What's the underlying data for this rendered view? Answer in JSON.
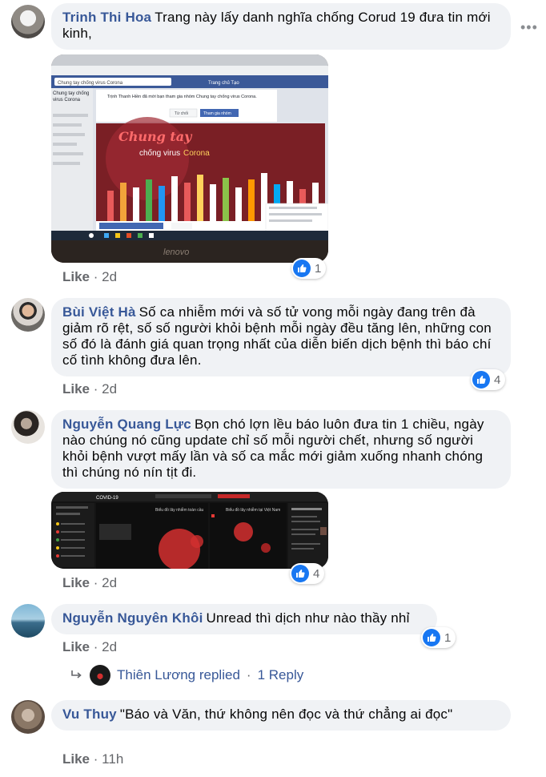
{
  "comments": [
    {
      "author": "Trinh Thi Hoa",
      "text": "Trang này lấy danh nghĩa chống Corud 19 đưa tin mới kinh,",
      "like": "Like",
      "sep": "·",
      "time": "2d",
      "reactions": "1",
      "image": {
        "search": "Chung tay chống virus Corona",
        "prompt": "Trịnh Thanh Hiền đã mời bạn tham gia nhóm Chung tay chống virus Corona.",
        "btn_decline": "Từ chối",
        "btn_join": "Tham gia nhóm",
        "banner_line1": "Chung tay",
        "banner_line2a": "chống virus",
        "banner_line2b": "Corona",
        "laptop_brand": "lenovo",
        "sidebar_group": "Chung tay chống virus Corona"
      }
    },
    {
      "author": "Bùi Việt Hà",
      "text": "Số ca nhiễm mới và số tử vong mỗi ngày đang trên đà giảm rõ rệt, số số người khỏi bệnh mỗi ngày đều tăng lên, những con số đó là đánh giá quan trọng nhất của diễn biến dịch bệnh thì báo chí cố tình không đưa lên.",
      "like": "Like",
      "sep": "·",
      "time": "2d",
      "reactions": "4"
    },
    {
      "author": "Nguyễn Quang Lực",
      "text": "Bọn chó lợn lều báo luôn đưa tin 1 chiều, ngày nào chúng nó cũng update chỉ số mỗi người chết, nhưng số người khỏi bệnh vượt mấy lần và số ca mắc mới giảm xuống nhanh chóng thì chúng nó nín tịt đi.",
      "like": "Like",
      "sep": "·",
      "time": "2d",
      "reactions": "4",
      "image": {
        "title": "COVID-19",
        "map1_title": "Biểu đồ lây nhiễm toàn cầu",
        "map2_title": "Biểu đồ lây nhiễm tại Việt Nam"
      }
    },
    {
      "author": "Nguyễn Nguyên Khôi",
      "text": "Unread thì dịch như nào thầy nhỉ",
      "like": "Like",
      "sep": "·",
      "time": "2d",
      "reactions": "1",
      "reply": {
        "name": "Thiên Lương replied",
        "sep": "·",
        "count": "1 Reply"
      }
    },
    {
      "author": "Vu Thuy",
      "text": "\"Báo và Văn, thứ không nên đọc và thứ chẳng ai đọc\"",
      "like": "Like",
      "sep": "·",
      "time": "11h"
    }
  ],
  "icons": {
    "more": "more-options-icon",
    "like": "like-reaction-icon",
    "reply_arrow": "reply-arrow-icon"
  },
  "colors": {
    "author": "#385898",
    "bubble": "#f0f2f5",
    "meta": "#65676b",
    "like_blue": "#1877f2"
  }
}
